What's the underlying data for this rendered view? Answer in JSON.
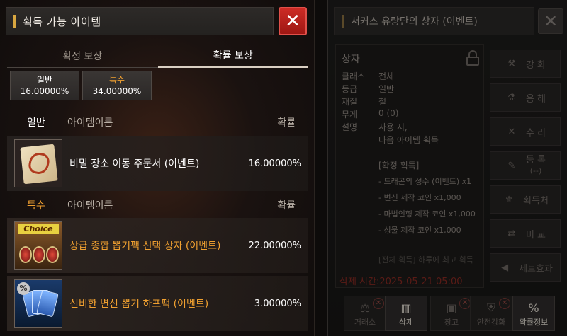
{
  "left_panel": {
    "title": "획득 가능 아이템",
    "close_label": "✕",
    "tabs": [
      {
        "label": "확정 보상",
        "active": false
      },
      {
        "label": "확률 보상",
        "active": true
      }
    ],
    "grade_summary": [
      {
        "name": "일반",
        "rate": "16.00000%"
      },
      {
        "name": "특수",
        "rate": "34.00000%"
      }
    ],
    "sections": [
      {
        "grade": "일반",
        "col_name": "아이템이름",
        "col_rate": "확률",
        "items": [
          {
            "icon": "scroll-icon",
            "name": "비밀 장소 이동 주문서 (이벤트)",
            "rate": "16.00000%"
          }
        ]
      },
      {
        "grade": "특수",
        "col_name": "아이템이름",
        "col_rate": "확률",
        "items": [
          {
            "icon": "choice-box-icon",
            "icon_text": "Choice",
            "name": "상급 종합 뽑기팩 선택 상자 (이벤트)",
            "rate": "22.00000%"
          },
          {
            "icon": "card-pack-icon",
            "icon_text": "%",
            "name": "신비한 변신 뽑기 하프팩 (이벤트)",
            "rate": "3.00000%"
          }
        ]
      }
    ]
  },
  "right_panel": {
    "title": "서커스 유랑단의 상자 (이벤트)",
    "close_label": "✕",
    "info": {
      "title": "상자",
      "rows": [
        {
          "k": "클래스",
          "v": "전체"
        },
        {
          "k": "등급",
          "v": "일반"
        },
        {
          "k": "재질",
          "v": "철"
        },
        {
          "k": "무게",
          "v": "0 (0)"
        },
        {
          "k": "설명",
          "v": "사용 시,"
        }
      ],
      "desc": [
        "다음 아이템 획득",
        "[확정 획득]",
        "- 드래곤의 성수 (이벤트) x1",
        "- 변신 제작 코인 x1,000",
        "- 마법인형 제작 코인 x1,000",
        "- 성물 제작 코인 x1,000",
        "[전체 획득] 하루에 최고 획득"
      ],
      "delete_time": "삭제 시간:2025-05-21 05:00"
    },
    "side_buttons": [
      {
        "icon": "anvil-icon",
        "glyph": "⚒",
        "label": "강 화"
      },
      {
        "icon": "flask-icon",
        "glyph": "⚗",
        "label": "용 해"
      },
      {
        "icon": "wrench-icon",
        "glyph": "✕",
        "label": "수 리"
      },
      {
        "icon": "register-icon",
        "glyph": "✎",
        "label": "등 록",
        "sub": "(--)"
      },
      {
        "icon": "source-icon",
        "glyph": "⚜",
        "label": "획득처"
      },
      {
        "icon": "compare-icon",
        "glyph": "⇄",
        "label": "비 교"
      },
      {
        "icon": "set-effect-icon",
        "glyph": "◀",
        "label": "세트효과"
      }
    ],
    "bottom_buttons": [
      {
        "icon": "scale-icon",
        "glyph": "⚖",
        "label": "거래소",
        "blocked": true,
        "bright": false
      },
      {
        "icon": "trash-icon",
        "glyph": "🗑",
        "label": "삭제",
        "blocked": false,
        "bright": true
      },
      {
        "icon": "warehouse-icon",
        "glyph": "▣",
        "label": "창고",
        "blocked": true,
        "bright": false
      },
      {
        "icon": "safe-enhance-icon",
        "glyph": "⛨",
        "label": "안전강화",
        "blocked": true,
        "bright": false
      },
      {
        "icon": "percent-icon",
        "glyph": "%",
        "label": "확률정보",
        "blocked": false,
        "bright": true
      }
    ]
  }
}
